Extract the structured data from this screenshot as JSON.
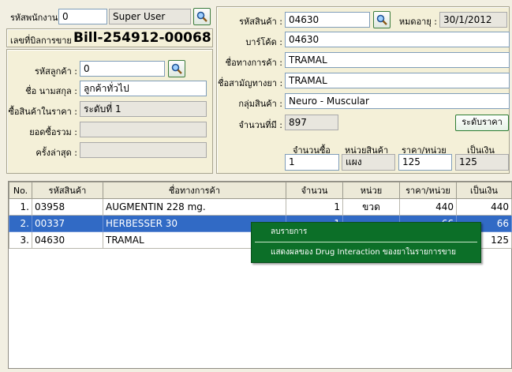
{
  "header": {
    "employee_id_label": "รหัสพนักงาน",
    "employee_id_value": "0",
    "employee_name_value": "Super User",
    "bill_label": "เลขที่บิลการขาย",
    "bill_value": "Bill-254912-00068"
  },
  "customer": {
    "code_label": "รหัสลูกค้า :",
    "code_value": "0",
    "name_label": "ชื่อ นามสกุล :",
    "name_value": "ลูกค้าทั่วไป",
    "price_level_label": "ซื้อสินค้าในราคา :",
    "price_level_value": "ระดับที่ 1",
    "total_purchase_label": "ยอดซื้อรวม :",
    "total_purchase_value": "",
    "last_time_label": "ครั้งล่าสุด :",
    "last_time_value": ""
  },
  "product": {
    "code_label": "รหัสสินค้า :",
    "code_value": "04630",
    "expiry_label": "หมดอายุ :",
    "expiry_value": "30/1/2012",
    "barcode_label": "บาร์โค้ด :",
    "barcode_value": "04630",
    "trade_name_label": "ชื่อทางการค้า :",
    "trade_name_value": "TRAMAL",
    "generic_name_label": "ชื่อสามัญทางยา :",
    "generic_name_value": "TRAMAL",
    "group_label": "กลุ่มสินค้า :",
    "group_value": "Neuro - Muscular",
    "stock_label": "จำนวนที่มี :",
    "stock_value": "897",
    "price_level_button": "ระดับราคา",
    "qty_label": "จำนวนซื้อ",
    "qty_value": "1",
    "unit_label": "หน่วยสินค้า",
    "unit_value": "แผง",
    "unit_price_label": "ราคา/หน่วย",
    "unit_price_value": "125",
    "amount_label": "เป็นเงิน",
    "amount_value": "125"
  },
  "table": {
    "columns": [
      "No.",
      "รหัสสินค้า",
      "ชื่อทางการค้า",
      "จำนวน",
      "หน่วย",
      "ราคา/หน่วย",
      "เป็นเงิน"
    ],
    "rows": [
      {
        "no": "1.",
        "code": "03958",
        "name": "AUGMENTIN 228 mg.",
        "qty": "1",
        "unit": "ขวด",
        "price": "440",
        "amount": "440"
      },
      {
        "no": "2.",
        "code": "00337",
        "name": "HERBESSER 30",
        "qty": "1",
        "unit": "",
        "price": "66",
        "amount": "66"
      },
      {
        "no": "3.",
        "code": "04630",
        "name": "TRAMAL",
        "qty": "1",
        "unit": "",
        "price": "125",
        "amount": "125"
      }
    ]
  },
  "context_menu": {
    "delete_item": "ลบรายการ",
    "drug_interaction_item": "แสดงผลของ Drug Interaction ของยาในรายการขาย"
  }
}
